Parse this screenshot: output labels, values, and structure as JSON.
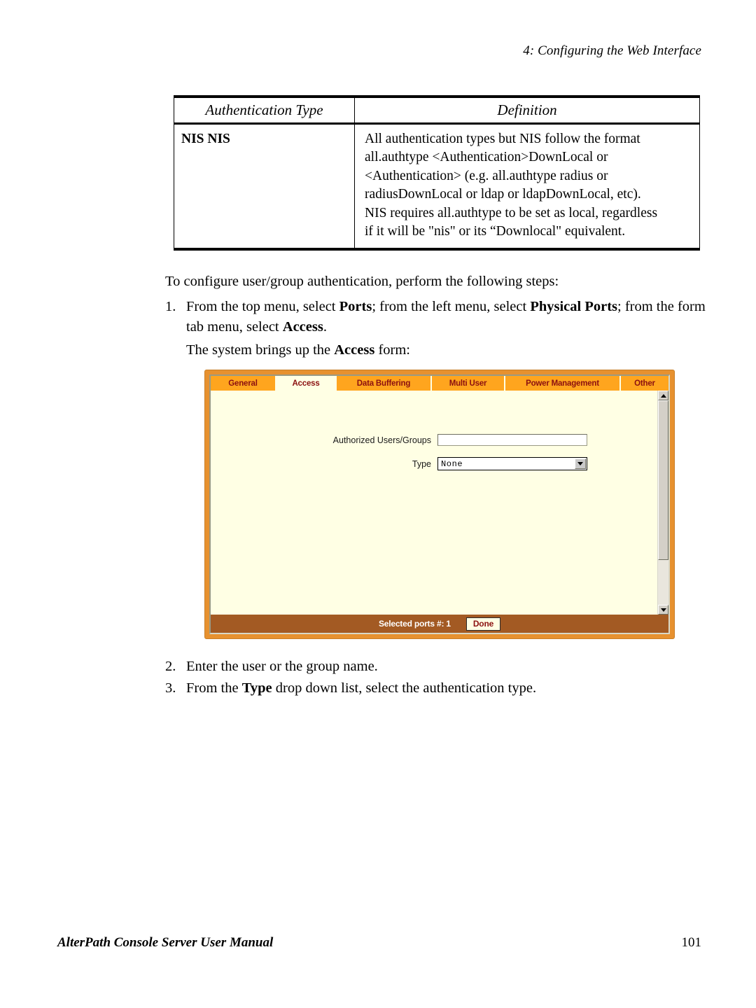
{
  "header": {
    "running_head": "4: Configuring the Web Interface"
  },
  "table": {
    "columns": [
      "Authentication Type",
      "Definition"
    ],
    "rows": [
      {
        "type": "NIS NIS",
        "definition_lines": [
          "All authentication types but NIS follow the format",
          "all.authtype <Authentication>DownLocal or",
          "<Authentication> (e.g. all.authtype radius or",
          "radiusDownLocal or ldap or ldapDownLocal, etc).",
          "NIS requires all.authtype to be set as local, regardless",
          "if it will be \"nis\" or its “Downlocal\" equivalent."
        ]
      }
    ]
  },
  "body": {
    "intro": "To configure user/group authentication, perform the following steps:",
    "step1": {
      "number": "1.",
      "part1": "From the top menu, select ",
      "bold1": "Ports",
      "part2": "; from the left menu, select ",
      "bold2": "Physical Ports",
      "part3": "; from the form tab menu, select ",
      "bold3": "Access",
      "part4": "."
    },
    "step1_sub": {
      "part1": "The system brings up the ",
      "bold1": "Access",
      "part2": " form:"
    },
    "step2": {
      "number": "2.",
      "text": "Enter the user or the group name."
    },
    "step3": {
      "number": "3.",
      "part1": "From the ",
      "bold1": "Type",
      "part2": " drop down list, select the authentication type."
    }
  },
  "app_screenshot": {
    "tabs": [
      {
        "label": "General",
        "active": false
      },
      {
        "label": "Access",
        "active": true
      },
      {
        "label": "Data Buffering",
        "active": false
      },
      {
        "label": "Multi User",
        "active": false
      },
      {
        "label": "Power Management",
        "active": false
      },
      {
        "label": "Other",
        "active": false
      }
    ],
    "form": {
      "authorized_label": "Authorized Users/Groups",
      "authorized_value": "",
      "type_label": "Type",
      "type_value": "None"
    },
    "status": {
      "selected_ports": "Selected ports #: 1",
      "done_label": "Done"
    },
    "colors": {
      "frame_orange": "#E7912F",
      "tab_orange": "#FFA51E",
      "tab_text": "#8B1010",
      "content_cream": "#FFFFE4",
      "status_brown": "#A35A23"
    }
  },
  "footer": {
    "manual_title": "AlterPath Console Server User Manual",
    "page_number": "101"
  }
}
